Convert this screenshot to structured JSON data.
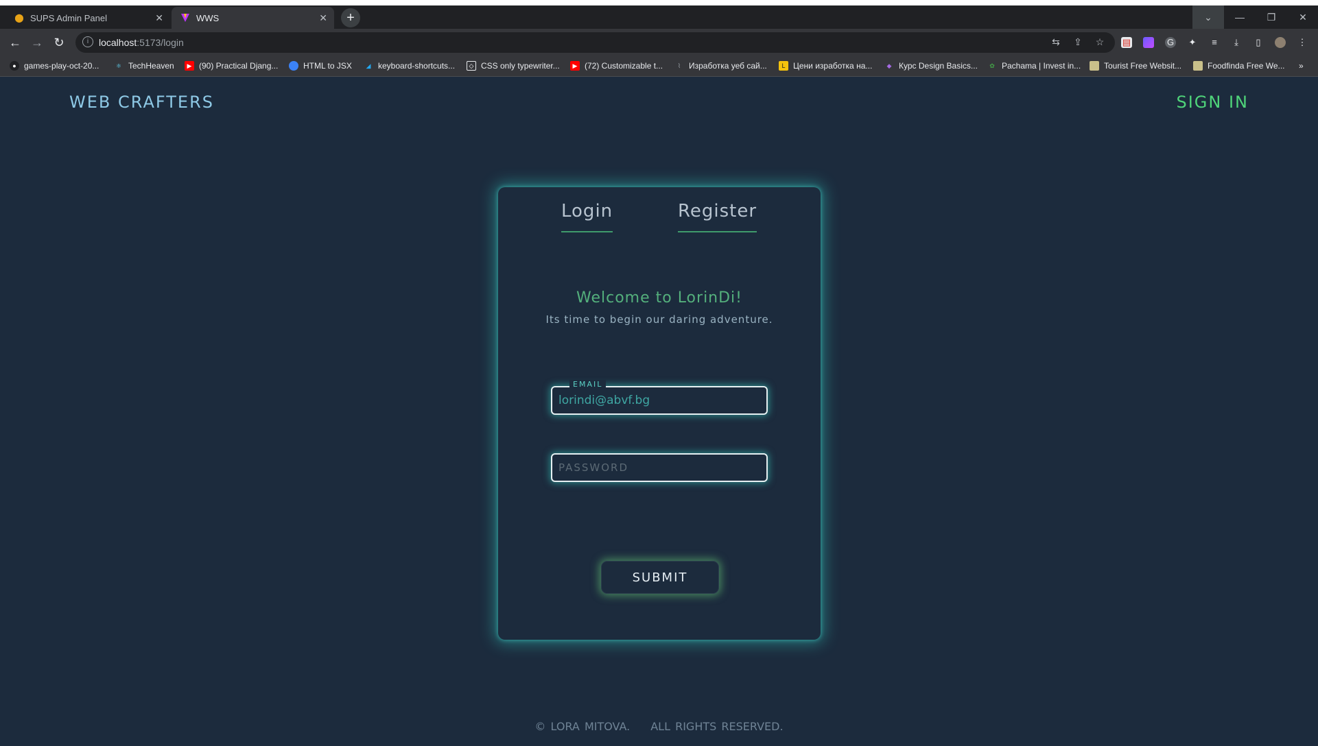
{
  "browser": {
    "tabs": [
      {
        "title": "SUPS Admin Panel",
        "active": false,
        "icon": "sups-logo-icon"
      },
      {
        "title": "WWS",
        "active": true,
        "icon": "vite-logo-icon"
      }
    ],
    "url_host": "localhost",
    "url_path": ":5173/login",
    "bookmarks": [
      {
        "label": "games-play-oct-20...",
        "icon": "github-icon",
        "color": "#e8eaed"
      },
      {
        "label": "TechHeaven",
        "icon": "react-icon",
        "color": "#61dafb"
      },
      {
        "label": "(90) Practical Djang...",
        "icon": "youtube-icon",
        "color": "#ff0000"
      },
      {
        "label": "HTML to JSX",
        "icon": "transform-icon",
        "color": "#3b82f6"
      },
      {
        "label": "keyboard-shortcuts...",
        "icon": "vscode-icon",
        "color": "#23a9f2"
      },
      {
        "label": "CSS only typewriter...",
        "icon": "codepen-icon",
        "color": "#e8eaed"
      },
      {
        "label": "(72) Customizable t...",
        "icon": "youtube-icon",
        "color": "#ff0000"
      },
      {
        "label": "Изработка уеб сай...",
        "icon": "site-icon",
        "color": "#9aa0a6"
      },
      {
        "label": "Цени изработка на...",
        "icon": "site-icon",
        "color": "#f4c20d"
      },
      {
        "label": "Курс Design Basics...",
        "icon": "school-icon",
        "color": "#a56be3"
      },
      {
        "label": "Pachama | Invest in...",
        "icon": "leaf-icon",
        "color": "#43a047"
      },
      {
        "label": "Tourist Free Websit...",
        "icon": "folder-icon",
        "color": "#c9c08a"
      },
      {
        "label": "Foodfinda Free We...",
        "icon": "folder-icon",
        "color": "#c9c08a"
      }
    ]
  },
  "header": {
    "brand": "WEB CRAFTERS",
    "signin": "SIGN IN"
  },
  "card": {
    "tab_login": "Login",
    "tab_register": "Register",
    "welcome": "Welcome to LorinDi!",
    "subtitle": "Its time to begin our daring adventure.",
    "email_label": "EMAIL",
    "email_value": "lorindi@abvf.bg",
    "password_placeholder": "PASSWORD",
    "submit": "SUBMIT"
  },
  "footer": {
    "copyright": "© LORA MITOVA.",
    "rights": "ALL RIGHTS RESERVED."
  },
  "colors": {
    "background": "#1c2b3d",
    "brand": "#8ec9e6",
    "signin": "#4fd47a",
    "welcome": "#54b07c",
    "glow": "#34c8be"
  }
}
